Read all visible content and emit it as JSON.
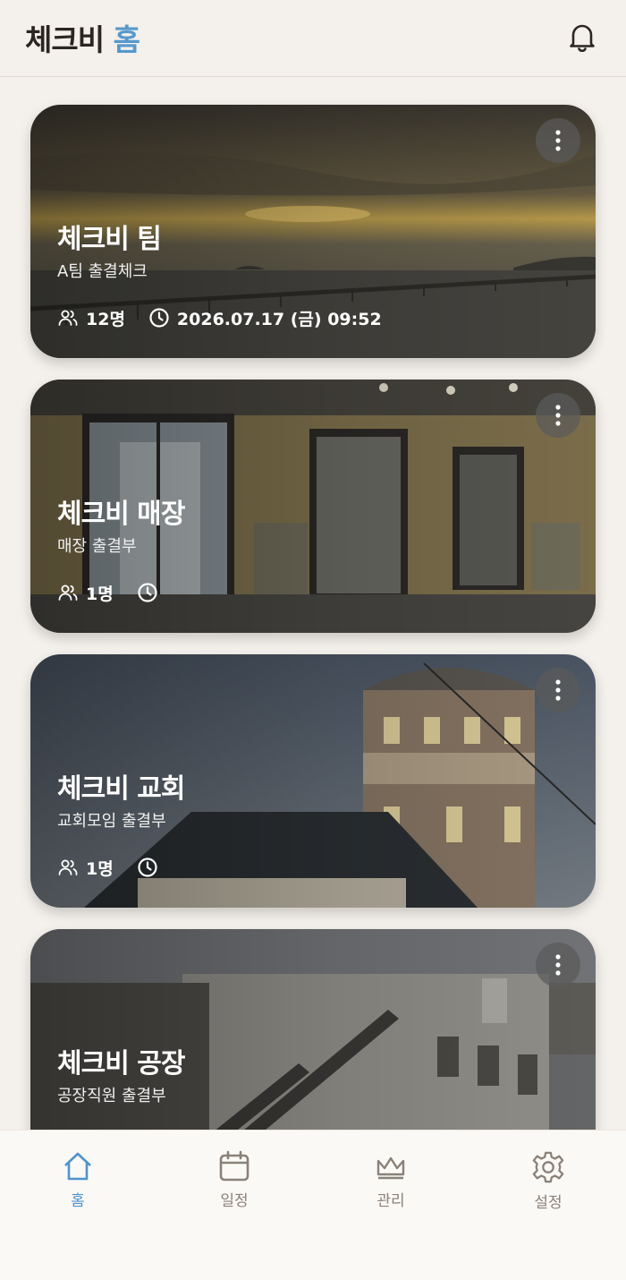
{
  "header": {
    "title_main": "체크비",
    "title_accent": "홈",
    "bell_icon": "bell-icon"
  },
  "cards": [
    {
      "title": "체크비 팀",
      "subtitle": "A팀 출결체크",
      "members": "12명",
      "datetime": "2026.07.17 (금) 09:52",
      "scene": "sunset-sea-bridge"
    },
    {
      "title": "체크비 매장",
      "subtitle": "매장 출결부",
      "members": "1명",
      "datetime": "",
      "scene": "store-entrance"
    },
    {
      "title": "체크비 교회",
      "subtitle": "교회모임 출결부",
      "members": "1명",
      "datetime": "",
      "scene": "church-tower"
    },
    {
      "title": "체크비 공장",
      "subtitle": "공장직원 출결부",
      "members": "",
      "datetime": "",
      "scene": "factory-stairs"
    }
  ],
  "nav": {
    "home": "홈",
    "schedule": "일정",
    "manage": "관리",
    "settings": "설정"
  },
  "colors": {
    "accent": "#5599cc",
    "active_nav": "#4f93cf",
    "inactive_nav": "#8a8178",
    "background": "#f4f0eb"
  }
}
